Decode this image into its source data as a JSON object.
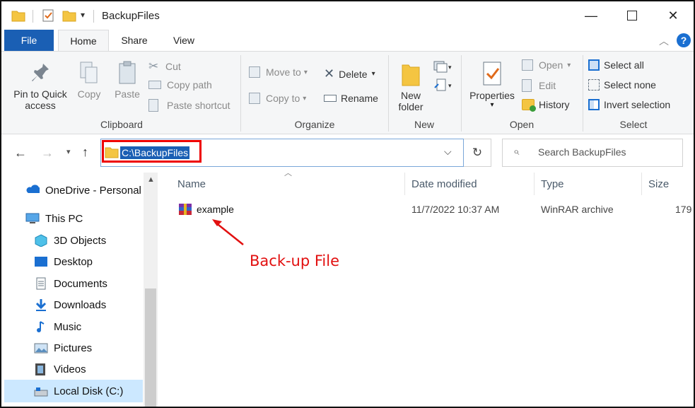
{
  "window": {
    "title": "BackupFiles"
  },
  "ribbon_tabs": [
    "File",
    "Home",
    "Share",
    "View"
  ],
  "clipboard": {
    "pin_line1": "Pin to Quick",
    "pin_line2": "access",
    "copy": "Copy",
    "paste": "Paste",
    "cut": "Cut",
    "copy_path": "Copy path",
    "paste_shortcut": "Paste shortcut",
    "group": "Clipboard"
  },
  "organize": {
    "move_to": "Move to",
    "copy_to": "Copy to",
    "delete": "Delete",
    "rename": "Rename",
    "group": "Organize"
  },
  "new": {
    "new_folder_line1": "New",
    "new_folder_line2": "folder",
    "group": "New"
  },
  "open": {
    "properties": "Properties",
    "open": "Open",
    "edit": "Edit",
    "history": "History",
    "group": "Open"
  },
  "select": {
    "select_all": "Select all",
    "select_none": "Select none",
    "invert_selection": "Invert selection",
    "group": "Select"
  },
  "address": {
    "path": "C:\\BackupFiles"
  },
  "search": {
    "placeholder": "Search BackupFiles"
  },
  "nav_pane": {
    "items": [
      {
        "label": "OneDrive - Personal",
        "icon": "onedrive-icon"
      },
      {
        "label": "This PC",
        "icon": "this-pc-icon"
      },
      {
        "label": "3D Objects",
        "icon": "3d-objects-icon"
      },
      {
        "label": "Desktop",
        "icon": "desktop-icon"
      },
      {
        "label": "Documents",
        "icon": "documents-icon"
      },
      {
        "label": "Downloads",
        "icon": "downloads-icon"
      },
      {
        "label": "Music",
        "icon": "music-icon"
      },
      {
        "label": "Pictures",
        "icon": "pictures-icon"
      },
      {
        "label": "Videos",
        "icon": "videos-icon"
      },
      {
        "label": "Local Disk (C:)",
        "icon": "local-disk-icon"
      }
    ],
    "selected": "Local Disk (C:)"
  },
  "columns": [
    "Name",
    "Date modified",
    "Type",
    "Size"
  ],
  "files": [
    {
      "name": "example",
      "date_modified": "11/7/2022 10:37 AM",
      "type": "WinRAR archive",
      "size": "179"
    }
  ],
  "annotation": {
    "text": "Back-up File"
  },
  "colors": {
    "accent": "#1a5fb4",
    "annotation_red": "#e21010",
    "selection": "#cce8ff"
  }
}
